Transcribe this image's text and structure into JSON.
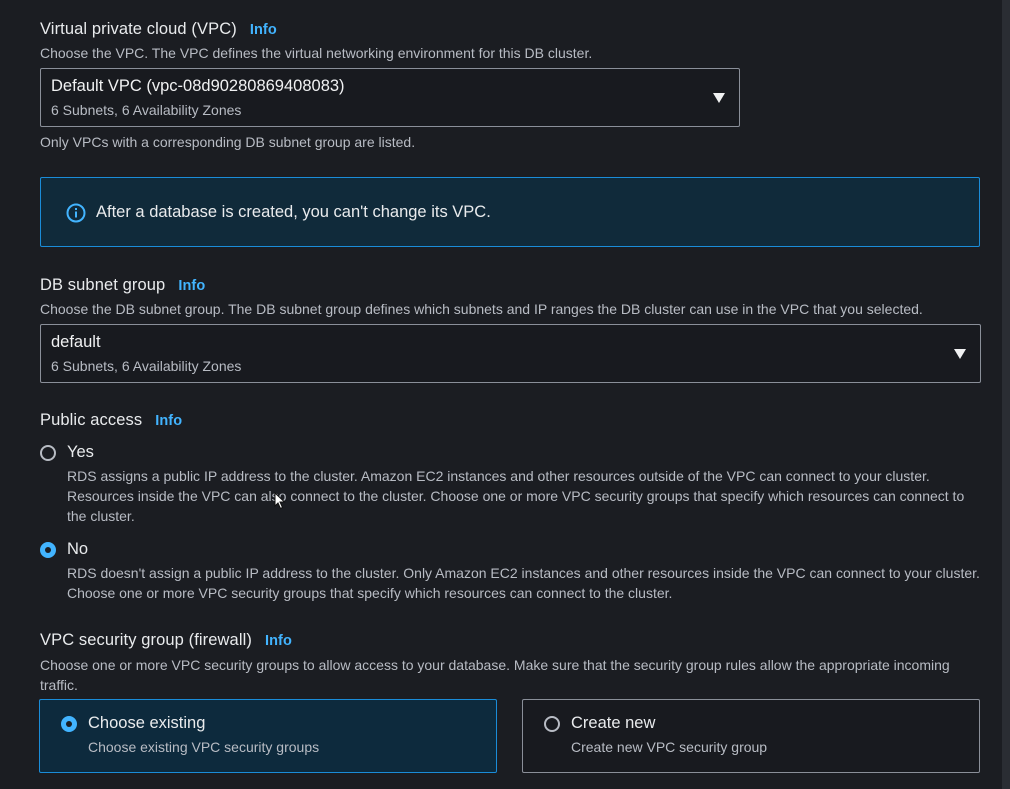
{
  "colors": {
    "background": "#1b1d22",
    "info_link": "#42b4ff",
    "alert_border": "#1a8cd8",
    "alert_bg": "#102a3a",
    "radio_selected": "#42b4ff"
  },
  "vpc": {
    "title": "Virtual private cloud (VPC)",
    "info": "Info",
    "description": "Choose the VPC. The VPC defines the virtual networking environment for this DB cluster.",
    "selected_value": "Default VPC (vpc-08d90280869408083)",
    "selected_sub": "6 Subnets, 6 Availability Zones",
    "hint": "Only VPCs with a corresponding DB subnet group are listed."
  },
  "alert": {
    "icon": "info-circle-icon",
    "text": "After a database is created, you can't change its VPC."
  },
  "subnet_group": {
    "title": "DB subnet group",
    "info": "Info",
    "description": "Choose the DB subnet group. The DB subnet group defines which subnets and IP ranges the DB cluster can use in the VPC that you selected.",
    "selected_value": "default",
    "selected_sub": "6 Subnets, 6 Availability Zones"
  },
  "public_access": {
    "title": "Public access",
    "info": "Info",
    "options": [
      {
        "label": "Yes",
        "selected": false,
        "description": "RDS assigns a public IP address to the cluster. Amazon EC2 instances and other resources outside of the VPC can connect to your cluster. Resources inside the VPC can also connect to the cluster. Choose one or more VPC security groups that specify which resources can connect to the cluster."
      },
      {
        "label": "No",
        "selected": true,
        "description": "RDS doesn't assign a public IP address to the cluster. Only Amazon EC2 instances and other resources inside the VPC can connect to your cluster. Choose one or more VPC security groups that specify which resources can connect to the cluster."
      }
    ]
  },
  "security_group": {
    "title": "VPC security group (firewall)",
    "info": "Info",
    "description": "Choose one or more VPC security groups to allow access to your database. Make sure that the security group rules allow the appropriate incoming traffic.",
    "tiles": [
      {
        "title": "Choose existing",
        "subtitle": "Choose existing VPC security groups",
        "selected": true
      },
      {
        "title": "Create new",
        "subtitle": "Create new VPC security group",
        "selected": false
      }
    ]
  }
}
